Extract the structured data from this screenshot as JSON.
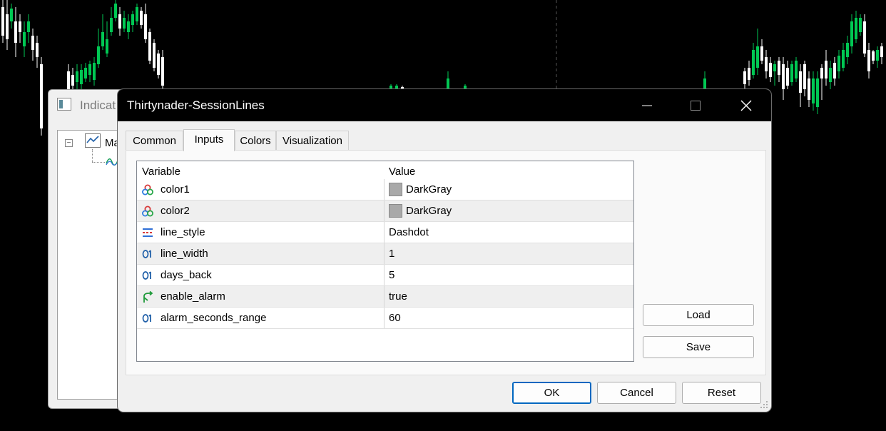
{
  "background_window": {
    "title": "Indicat",
    "tree_item_label": "Ma"
  },
  "dialog": {
    "title": "Thirtynader-SessionLines",
    "window_controls": {
      "minimize": "—",
      "maximize": "☐",
      "close": "✕"
    },
    "tabs": [
      {
        "label": "Common",
        "active": false
      },
      {
        "label": "Inputs",
        "active": true
      },
      {
        "label": "Colors",
        "active": false
      },
      {
        "label": "Visualization",
        "active": false
      }
    ],
    "grid": {
      "headers": {
        "variable": "Variable",
        "value": "Value"
      },
      "rows": [
        {
          "name": "color1",
          "value": "DarkGray",
          "icon": "color-icon",
          "swatch": "#a9a9a9"
        },
        {
          "name": "color2",
          "value": "DarkGray",
          "icon": "color-icon",
          "swatch": "#a9a9a9"
        },
        {
          "name": "line_style",
          "value": "Dashdot",
          "icon": "line-style-icon"
        },
        {
          "name": "line_width",
          "value": "1",
          "icon": "integer-icon"
        },
        {
          "name": "days_back",
          "value": "5",
          "icon": "integer-icon"
        },
        {
          "name": "enable_alarm",
          "value": "true",
          "icon": "boolean-icon"
        },
        {
          "name": "alarm_seconds_range",
          "value": "60",
          "icon": "integer-icon"
        }
      ]
    },
    "buttons": {
      "load": "Load",
      "save": "Save",
      "ok": "OK",
      "cancel": "Cancel",
      "reset": "Reset"
    }
  },
  "colors": {
    "chart_bg": "#000000",
    "candle_bull": "#00c853",
    "candle_bear": "#ffffff",
    "accent_focus": "#0067c0",
    "swatch_darkgray": "#a9a9a9"
  }
}
